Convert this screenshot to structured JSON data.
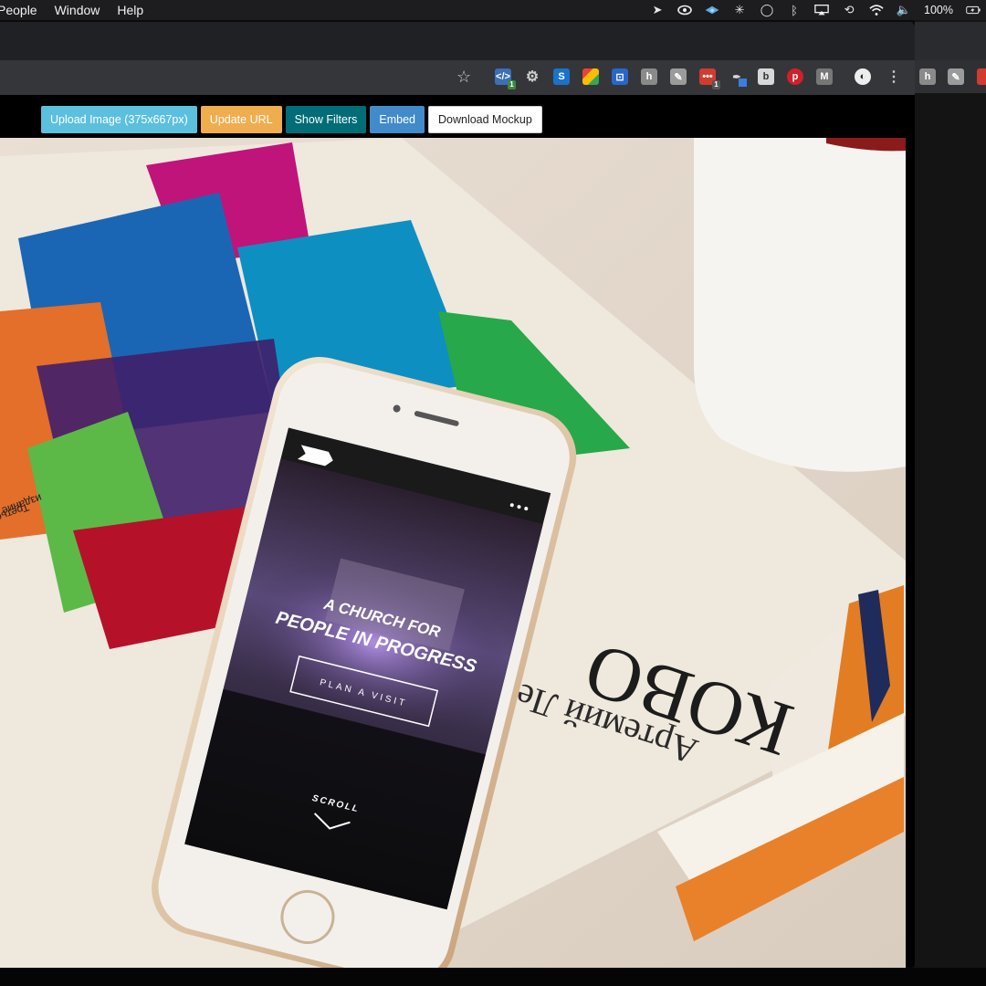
{
  "menubar": {
    "items": [
      "People",
      "Window",
      "Help"
    ],
    "battery": "100%"
  },
  "toolbar": {
    "ext_badges": [
      "1",
      "1"
    ]
  },
  "actions": {
    "upload": "Upload Image (375x667px)",
    "update_url": "Update URL",
    "show_filters": "Show Filters",
    "embed": "Embed",
    "download": "Download Mockup"
  },
  "mockup": {
    "book_title": "КОВО",
    "book_author": "Артемий Ле",
    "book_cover_text_1": "Третье",
    "book_cover_text_2": "издание",
    "screen_line1": "A CHURCH FOR",
    "screen_line2": "PEOPLE IN PROGRESS",
    "screen_button": "PLAN A VISIT",
    "screen_scroll": "SCROLL"
  },
  "colors": {
    "upload": "#5bc0de",
    "update_url": "#f0ad4e",
    "show_filters": "#006d77",
    "embed": "#428bca",
    "download": "#ffffff"
  }
}
